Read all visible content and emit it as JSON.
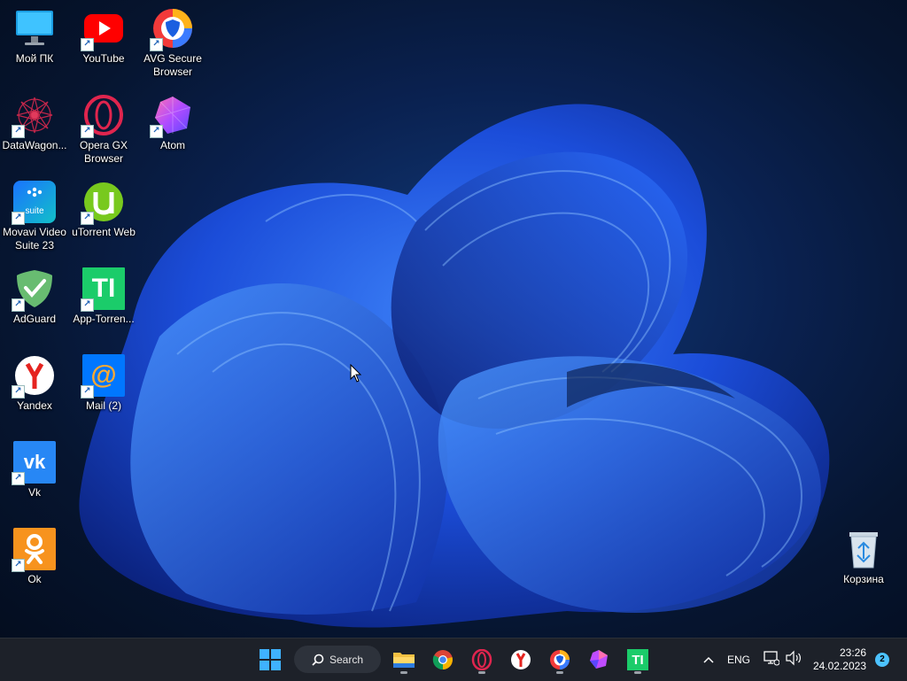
{
  "desktop": {
    "icons": [
      {
        "id": "my-pc",
        "label": "Мой ПК"
      },
      {
        "id": "youtube",
        "label": "YouTube"
      },
      {
        "id": "avg",
        "label": "AVG Secure\nBrowser"
      },
      {
        "id": "datawagon",
        "label": "DataWagon..."
      },
      {
        "id": "opera-gx",
        "label": "Opera GX\nBrowser"
      },
      {
        "id": "atom",
        "label": "Atom"
      },
      {
        "id": "movavi",
        "label": "Movavi Video\nSuite 23"
      },
      {
        "id": "utorrent",
        "label": "uTorrent Web"
      },
      {
        "id": "adguard",
        "label": "AdGuard"
      },
      {
        "id": "app-torrent",
        "label": "App-Torren..."
      },
      {
        "id": "yandex",
        "label": "Yandex"
      },
      {
        "id": "mail",
        "label": "Mail (2)"
      },
      {
        "id": "vk",
        "label": "Vk"
      },
      {
        "id": "ok",
        "label": "Ok"
      },
      {
        "id": "recycle-bin",
        "label": "Корзина"
      }
    ],
    "movavi_badge": "suite",
    "app_torrent_glyph": "TI",
    "mail_glyph": "@"
  },
  "taskbar": {
    "search_label": "Search",
    "apps": [
      "start",
      "search",
      "file-explorer",
      "chrome",
      "opera-gx",
      "yandex",
      "avg-browser",
      "atom",
      "app-torrent"
    ],
    "tray": {
      "language": "ENG",
      "time": "23:26",
      "date": "24.02.2023",
      "notification_count": "2"
    }
  },
  "colors": {
    "taskbar_bg": "#1d2129",
    "wallpaper_accent": "#1f5cff",
    "notification_badge": "#4cc2ff"
  }
}
